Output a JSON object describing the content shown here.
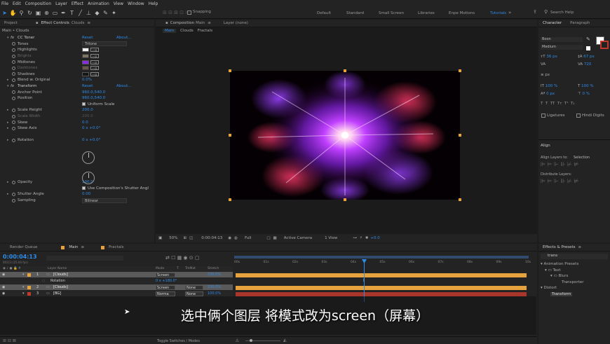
{
  "menu": [
    "File",
    "Edit",
    "Composition",
    "Layer",
    "Effect",
    "Animation",
    "View",
    "Window",
    "Help"
  ],
  "toolbar": {
    "snapping": "Snapping",
    "workspaces": [
      "Default",
      "Standard",
      "Small Screen",
      "Libraries",
      "Enpe Motions",
      "Tutorials"
    ],
    "search_placeholder": "Search Help"
  },
  "left_panel": {
    "tab_project": "Project",
    "tab_effect_controls": "Effect Controls",
    "tab_layer": "Clouds",
    "breadcrumb": "Main • Clouds"
  },
  "effects": [
    {
      "kind": "fx",
      "label": "CC Toner",
      "reset": "Reset",
      "about": "About..."
    },
    {
      "kind": "dd",
      "label": "Tones",
      "value": "Tritone"
    },
    {
      "kind": "color",
      "label": "Highlights",
      "color": "#f2f2f2"
    },
    {
      "kind": "color-dim",
      "label": "Brights",
      "color": "#e8d9b8"
    },
    {
      "kind": "color",
      "label": "Midtones",
      "color": "#8a2be2"
    },
    {
      "kind": "color-dim",
      "label": "Darktones",
      "color": "#b8a078"
    },
    {
      "kind": "color",
      "label": "Shadows",
      "color": "#151515"
    },
    {
      "kind": "val",
      "label": "Blend w. Original",
      "value": "0.0%"
    },
    {
      "kind": "fx",
      "label": "Transform",
      "reset": "Reset",
      "about": "About..."
    },
    {
      "kind": "val",
      "label": "Anchor Point",
      "value": "960.0,540.0"
    },
    {
      "kind": "val",
      "label": "Position",
      "value": "960.0,540.0"
    },
    {
      "kind": "check",
      "label": "",
      "value": "Uniform Scale"
    },
    {
      "kind": "val",
      "label": "Scale Height",
      "value": "200.0"
    },
    {
      "kind": "val-dim",
      "label": "Scale Width",
      "value": "200.0"
    },
    {
      "kind": "val",
      "label": "Skew",
      "value": "0.0"
    },
    {
      "kind": "val",
      "label": "Skew Axis",
      "value": "0 x +0.0°"
    }
  ],
  "effects2": [
    {
      "kind": "val",
      "label": "Rotation",
      "value": "0 x +0.0°"
    }
  ],
  "effects3": [
    {
      "kind": "val",
      "label": "Opacity",
      "value": "100.0"
    },
    {
      "kind": "check",
      "label": "",
      "value": "Use Composition's Shutter Angl"
    },
    {
      "kind": "val",
      "label": "Shutter Angle",
      "value": "0.00"
    },
    {
      "kind": "dd",
      "label": "Sampling",
      "value": "Bilinear"
    }
  ],
  "comp_panel": {
    "tab_composition": "Composition",
    "tab_comp_name": "Main",
    "tab_layer": "Layer (none)",
    "nav": [
      "Main",
      "Clouds",
      "Fractals"
    ]
  },
  "viewer_bar": {
    "zoom": "50%",
    "timecode": "0:00:04:13",
    "resolution": "Full",
    "camera": "Active Camera",
    "views": "1 View",
    "exposure": "+0.0"
  },
  "right_panel": {
    "character_tab": "Character",
    "paragraph_tab": "Paragraph",
    "font": "Boon",
    "style": "Medium",
    "size": "36 px",
    "leading": "67 px",
    "kerning": "",
    "tracking": "720",
    "stroke": "px",
    "vscale": "100 %",
    "hscale": "100 %",
    "baseline": "0 px",
    "tsume": "0 %",
    "ligatures": "Ligatures",
    "hindi": "Hindi Digits",
    "align_title": "Align",
    "align_to_label": "Align Layers to:",
    "align_to_value": "Selection",
    "distribute": "Distribute Layers:",
    "effects_presets": "Effects & Presets",
    "search_value": "trans",
    "tree": [
      "Animation Presets",
      "Text",
      "Blurs",
      "Transporter",
      "Distort",
      "Transform"
    ]
  },
  "timeline": {
    "tab_render": "Render Queue",
    "tab_main": "Main",
    "tab_fractals": "Fractals",
    "timecode": "0:00:04:13",
    "timecode_sub": "00113 (25.00 fps)",
    "search_placeholder": "",
    "columns": [
      "Layer Name",
      "Mode",
      "T",
      "TrkMat",
      "Stretch"
    ],
    "ruler": [
      "00s",
      "01s",
      "02s",
      "03s",
      "04s",
      "05s",
      "06s",
      "07s",
      "08s",
      "09s",
      "10s"
    ],
    "layers": [
      {
        "num": "1",
        "name": "[Clouds]",
        "mode": "Screen",
        "trkmat": "",
        "stretch": "100.0%",
        "color": "#e6a23c"
      },
      {
        "num": "",
        "name": "Rotation",
        "mode": "",
        "trkmat": "",
        "stretch": "0 x +180.0°",
        "color": ""
      },
      {
        "num": "2",
        "name": "[Clouds]",
        "mode": "Screen",
        "trkmat": "None",
        "stretch": "100.0%",
        "color": "#e6a23c"
      },
      {
        "num": "3",
        "name": "[BG]",
        "mode": "Norma",
        "trkmat": "None",
        "stretch": "100.0%",
        "color": "#c0392b"
      }
    ],
    "toggle": "Toggle Switches / Modes"
  },
  "subtitle": "选中俩个图层 将模式改为screen（屏幕）"
}
